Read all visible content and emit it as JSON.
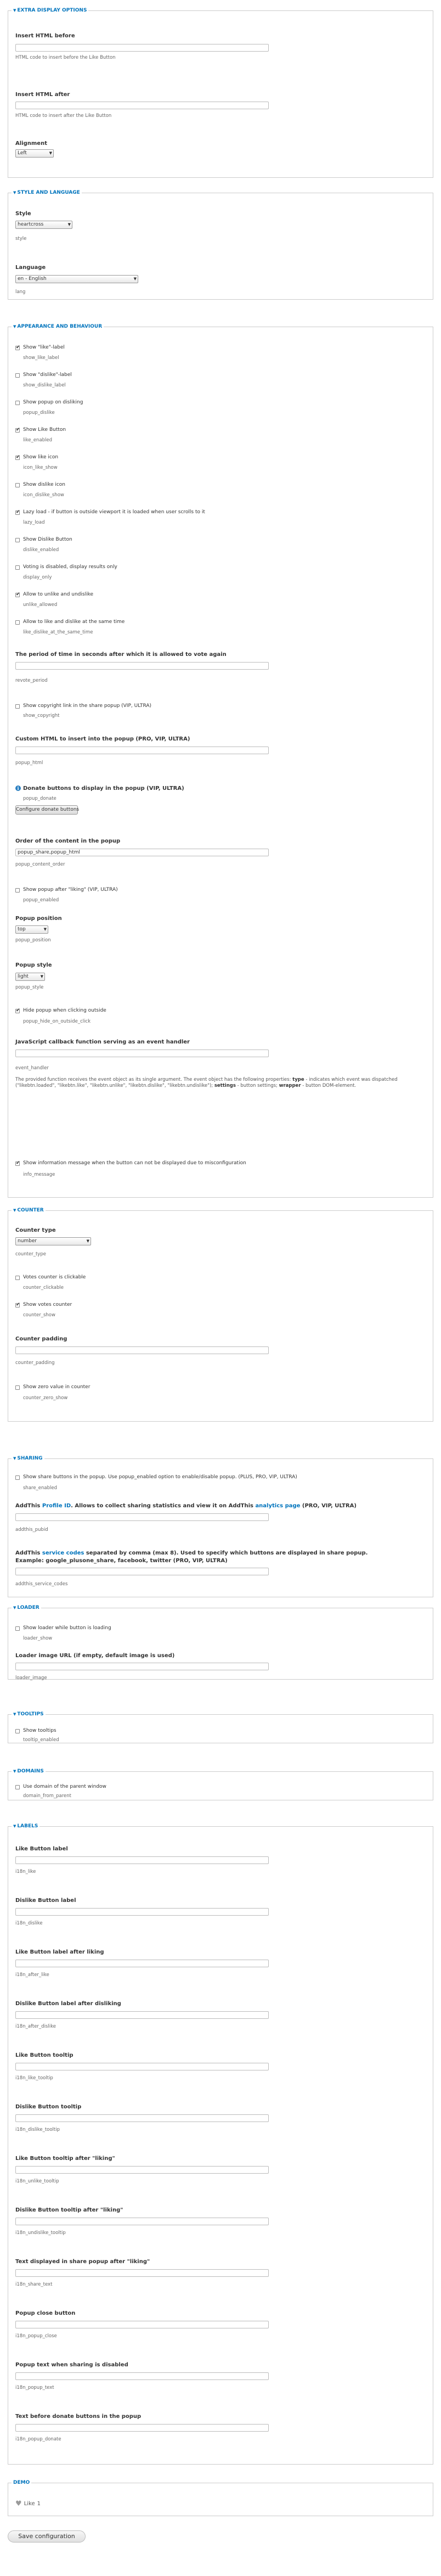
{
  "extra": {
    "legend": "EXTRA DISPLAY OPTIONS",
    "before_label": "Insert HTML before",
    "before_desc": "HTML code to insert before the Like Button",
    "after_label": "Insert HTML after",
    "after_desc": "HTML code to insert after the Like Button",
    "alignment_label": "Alignment",
    "alignment_value": "Left"
  },
  "style": {
    "legend": "STYLE AND LANGUAGE",
    "style_label": "Style",
    "style_value": "heartcross",
    "style_desc": "style",
    "lang_label": "Language",
    "lang_value": "en - English",
    "lang_desc": "lang"
  },
  "appearance": {
    "legend": "APPEARANCE AND BEHAVIOUR",
    "checks": [
      {
        "label": "Show \"like\"-label",
        "name": "show_like_label",
        "checked": true
      },
      {
        "label": "Show \"dislike\"-label",
        "name": "show_dislike_label",
        "checked": false
      },
      {
        "label": "Show popup on disliking",
        "name": "popup_dislike",
        "checked": false
      },
      {
        "label": "Show Like Button",
        "name": "like_enabled",
        "checked": true
      },
      {
        "label": "Show like icon",
        "name": "icon_like_show",
        "checked": true
      },
      {
        "label": "Show dislike icon",
        "name": "icon_dislike_show",
        "checked": false
      },
      {
        "label": "Lazy load - if button is outside viewport it is loaded when user scrolls to it",
        "name": "lazy_load",
        "checked": true
      },
      {
        "label": "Show Dislike Button",
        "name": "dislike_enabled",
        "checked": false
      },
      {
        "label": "Voting is disabled, display results only",
        "name": "display_only",
        "checked": false
      },
      {
        "label": "Allow to unlike and undislike",
        "name": "unlike_allowed",
        "checked": true
      },
      {
        "label": "Allow to like and dislike at the same time",
        "name": "like_dislike_at_the_same_time",
        "checked": false
      }
    ],
    "period_label": "The period of time in seconds after which it is allowed to vote again",
    "period_desc": "revote_period",
    "copyright_label": "Show copyright link in the share popup (VIP, ULTRA)",
    "copyright_desc": "show_copyright",
    "popup_html_label": "Custom HTML to insert into the popup (PRO, VIP, ULTRA)",
    "popup_html_desc": "popup_html",
    "donate_label": "Donate buttons to display in the popup (VIP, ULTRA)",
    "donate_desc": "popup_donate",
    "donate_button": "Configure donate buttons",
    "order_label": "Order of the content in the popup",
    "order_value": "popup_share,popup_html",
    "order_desc": "popup_content_order",
    "popup_after_label": "Show popup after \"liking\" (VIP, ULTRA)",
    "popup_after_desc": "popup_enabled",
    "position_label": "Popup position",
    "position_value": "top",
    "position_desc": "popup_position",
    "pstyle_label": "Popup style",
    "pstyle_value": "light",
    "pstyle_desc": "popup_style",
    "hide_popup_label": "Hide popup when clicking outside",
    "hide_popup_desc": "popup_hide_on_outside_click",
    "js_label": "JavaScript callback function serving as an event handler",
    "js_desc": "event_handler",
    "js_para1": "The provided function receives the event object as its single argument. The event object has the following properties:",
    "js_type": "type",
    "js_para2": "- indicates which event was dispatched (\"likebtn.loaded\", \"likebtn.like\", \"likebtn.unlike\", \"likebtn.dislike\", \"likebtn.undislike\");",
    "js_settings": "settings",
    "js_para3": "- button settings;",
    "js_wrapper": "wrapper",
    "js_para4": "- button DOM-element.",
    "info_msg_label": "Show information message when the button can not be displayed due to misconfiguration",
    "info_msg_desc": "info_message"
  },
  "counter": {
    "legend": "COUNTER",
    "type_label": "Counter type",
    "type_value": "number",
    "type_desc": "counter_type",
    "clickable_label": "Votes counter is clickable",
    "clickable_desc": "counter_clickable",
    "show_label": "Show votes counter",
    "show_desc": "counter_show",
    "padding_label": "Counter padding",
    "padding_desc": "counter_padding",
    "zero_label": "Show zero value in counter",
    "zero_desc": "counter_zero_show"
  },
  "sharing": {
    "legend": "SHARING",
    "share_label": "Show share buttons in the popup. Use popup_enabled option to enable/disable popup. (PLUS, PRO, VIP, ULTRA)",
    "share_desc": "share_enabled",
    "addthis_pre": "AddThis",
    "addthis_link1": "Profile ID",
    "addthis_mid": ". Allows to collect sharing statistics and view it on AddThis",
    "addthis_link2": "analytics page",
    "addthis_post": "(PRO, VIP, ULTRA)",
    "addthis_desc": "addthis_pubid",
    "codes_pre": "AddThis",
    "codes_link": "service codes",
    "codes_post": "separated by comma (max 8). Used to specify which buttons are displayed in share popup.",
    "codes_line2": "Example: google_plusone_share, facebook, twitter (PRO, VIP, ULTRA)",
    "codes_desc": "addthis_service_codes"
  },
  "loader": {
    "legend": "LOADER",
    "show_label": "Show loader while button is loading",
    "show_desc": "loader_show",
    "image_label": "Loader image URL (if empty, default image is used)",
    "image_desc": "loader_image"
  },
  "tooltips": {
    "legend": "TOOLTIPS",
    "show_label": "Show tooltips",
    "show_desc": "tooltip_enabled"
  },
  "domains": {
    "legend": "DOMAINS",
    "parent_label": "Use domain of the parent window",
    "parent_desc": "domain_from_parent"
  },
  "labels": {
    "legend": "LABELS",
    "fields": [
      {
        "label": "Like Button label",
        "desc": "i18n_like"
      },
      {
        "label": "Dislike Button label",
        "desc": "i18n_dislike"
      },
      {
        "label": "Like Button label after liking",
        "desc": "i18n_after_like"
      },
      {
        "label": "Dislike Button label after disliking",
        "desc": "i18n_after_dislike"
      },
      {
        "label": "Like Button tooltip",
        "desc": "i18n_like_tooltip"
      },
      {
        "label": "Dislike Button tooltip",
        "desc": "i18n_dislike_tooltip"
      },
      {
        "label": "Like Button tooltip after \"liking\"",
        "desc": "i18n_unlike_tooltip"
      },
      {
        "label": "Dislike Button tooltip after \"liking\"",
        "desc": "i18n_undislike_tooltip"
      },
      {
        "label": "Text displayed in share popup after \"liking\"",
        "desc": "i18n_share_text"
      },
      {
        "label": "Popup close button",
        "desc": "i18n_popup_close"
      },
      {
        "label": "Popup text when sharing is disabled",
        "desc": "i18n_popup_text"
      },
      {
        "label": "Text before donate buttons in the popup",
        "desc": "i18n_popup_donate"
      }
    ]
  },
  "demo": {
    "legend": "DEMO",
    "like_text": "Like",
    "like_count": "1"
  },
  "save_button": "Save configuration"
}
